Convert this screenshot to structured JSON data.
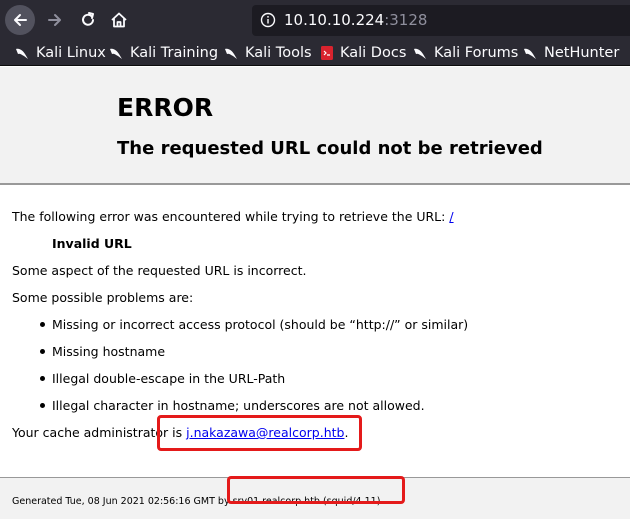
{
  "browser": {
    "url_host": "10.10.10.224",
    "url_port": ":3128",
    "bookmarks": [
      {
        "label": "Kali Linux",
        "icon": "kali-dragon-icon"
      },
      {
        "label": "Kali Training",
        "icon": "kali-dragon-icon"
      },
      {
        "label": "Kali Tools",
        "icon": "kali-dragon-icon"
      },
      {
        "label": "Kali Docs",
        "icon": "kali-docs-icon"
      },
      {
        "label": "Kali Forums",
        "icon": "kali-dragon-icon"
      },
      {
        "label": "NetHunter",
        "icon": "kali-dragon-icon"
      }
    ]
  },
  "page": {
    "title": "ERROR",
    "subtitle": "The requested URL could not be retrieved",
    "intro": "The following error was encountered while trying to retrieve the URL: ",
    "intro_link": "/",
    "error_name": "Invalid URL",
    "aspect": "Some aspect of the requested URL is incorrect.",
    "problems_heading": "Some possible problems are:",
    "problems": [
      "Missing or incorrect access protocol (should be “http://” or similar)",
      "Missing hostname",
      "Illegal double-escape in the URL-Path",
      "Illegal character in hostname; underscores are not allowed."
    ],
    "admin_prefix": "Your cache administrator is ",
    "admin_email": "j.nakazawa@realcorp.htb",
    "admin_suffix": ".",
    "footer_prefix": "Generated Tue, 08 Jun 2021 02:56:16 GMT by ",
    "footer_host": "srv01.realcorp.htb (squid/4.11)"
  },
  "colors": {
    "highlight": "#e41a1a",
    "link": "#0000ee"
  }
}
